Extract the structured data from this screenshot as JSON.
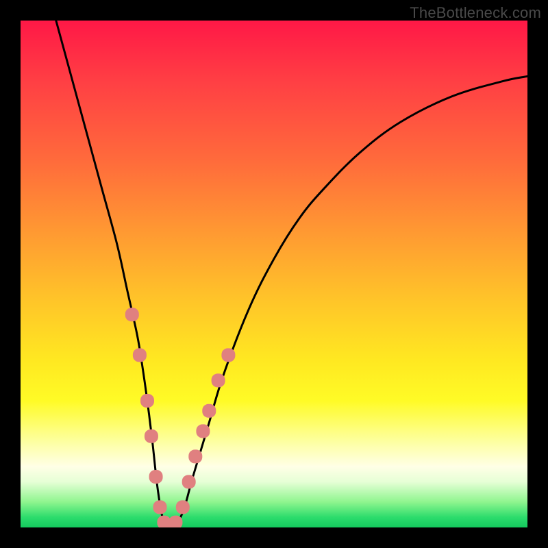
{
  "watermark": "TheBottleneck.com",
  "colors": {
    "frame": "#000000",
    "curve": "#000000",
    "marker_fill": "#e08080",
    "marker_stroke": "#c06a6a"
  },
  "chart_data": {
    "type": "line",
    "title": "",
    "xlabel": "",
    "ylabel": "",
    "xlim": [
      0,
      100
    ],
    "ylim": [
      0,
      100
    ],
    "grid": false,
    "legend": false,
    "note": "Values are approximate readings from an unlabeled bottleneck-style V curve; y is the deviation (0 at the optimum dip), x is the relative position along the horizontal axis.",
    "series": [
      {
        "name": "curve",
        "x": [
          7,
          10,
          13,
          16,
          19,
          21,
          23,
          24,
          25,
          26,
          27,
          28,
          29,
          30,
          32,
          34,
          37,
          40,
          45,
          50,
          55,
          60,
          67,
          75,
          85,
          95,
          100
        ],
        "y": [
          100,
          89,
          78,
          67,
          56,
          47,
          38,
          32,
          25,
          17,
          8,
          2,
          0,
          0,
          3,
          10,
          20,
          30,
          43,
          53,
          61,
          67,
          74,
          80,
          85,
          88,
          89
        ]
      }
    ],
    "markers": {
      "name": "highlighted-points",
      "x": [
        22,
        23.5,
        25,
        25.8,
        26.7,
        27.5,
        28.3,
        29,
        29.8,
        30.6,
        32,
        33.2,
        34.5,
        36,
        37.2,
        39,
        41
      ],
      "y": [
        42,
        34,
        25,
        18,
        10,
        4,
        1,
        0,
        0,
        1,
        4,
        9,
        14,
        19,
        23,
        29,
        34
      ]
    }
  }
}
